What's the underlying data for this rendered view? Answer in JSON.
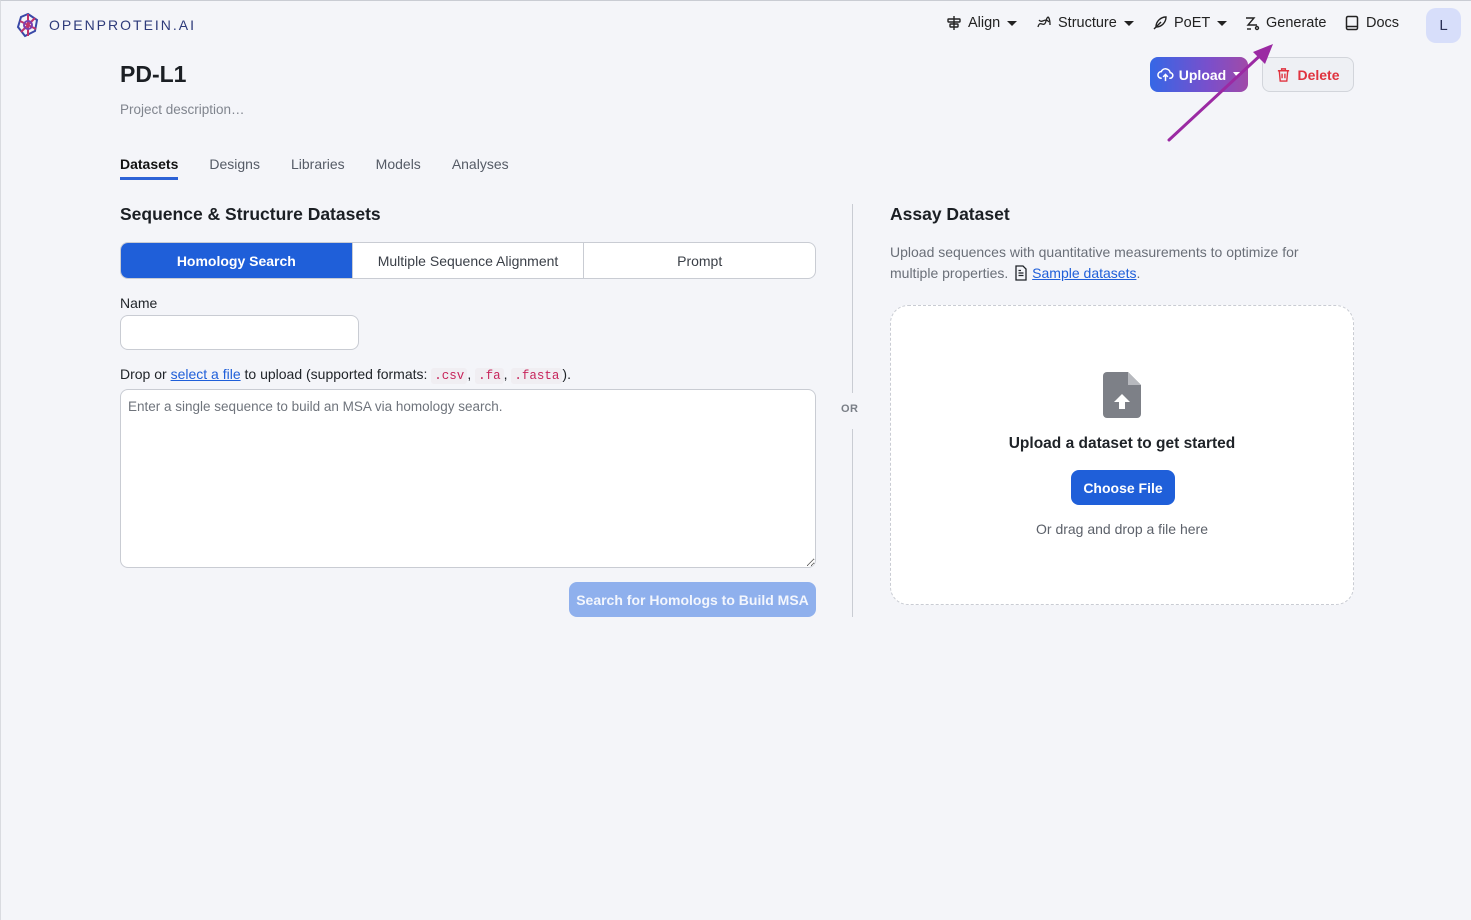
{
  "brand": {
    "name": "OPENPROTEIN.AI"
  },
  "nav": {
    "align": "Align",
    "structure": "Structure",
    "poet": "PoET",
    "generate": "Generate",
    "docs": "Docs",
    "avatar_initial": "L"
  },
  "project": {
    "title": "PD-L1",
    "description": "Project description…",
    "upload_label": "Upload",
    "delete_label": "Delete"
  },
  "tabs": [
    "Datasets",
    "Designs",
    "Libraries",
    "Models",
    "Analyses"
  ],
  "sequence_section": {
    "title": "Sequence & Structure Datasets",
    "modes": [
      "Homology Search",
      "Multiple Sequence Alignment",
      "Prompt"
    ],
    "name_label": "Name",
    "name_value": "",
    "drop_prefix": "Drop or ",
    "drop_link": "select a file",
    "drop_middle": " to upload (supported formats: ",
    "formats": [
      ".csv",
      ".fa",
      ".fasta"
    ],
    "drop_suffix": ").",
    "sequence_placeholder": "Enter a single sequence to build an MSA via homology search.",
    "search_button": "Search for Homologs to Build MSA"
  },
  "divider": {
    "or_label": "OR"
  },
  "assay_section": {
    "title": "Assay Dataset",
    "description": "Upload sequences with quantitative measurements to optimize for multiple properties.",
    "sample_link": "Sample datasets",
    "sample_suffix": ".",
    "dropzone_title": "Upload a dataset to get started",
    "choose_button": "Choose File",
    "dropzone_sub": "Or drag and drop a file here"
  },
  "colors": {
    "primary": "#1f5fd9",
    "danger": "#e0333f",
    "annotation_arrow": "#9b2aa3"
  }
}
